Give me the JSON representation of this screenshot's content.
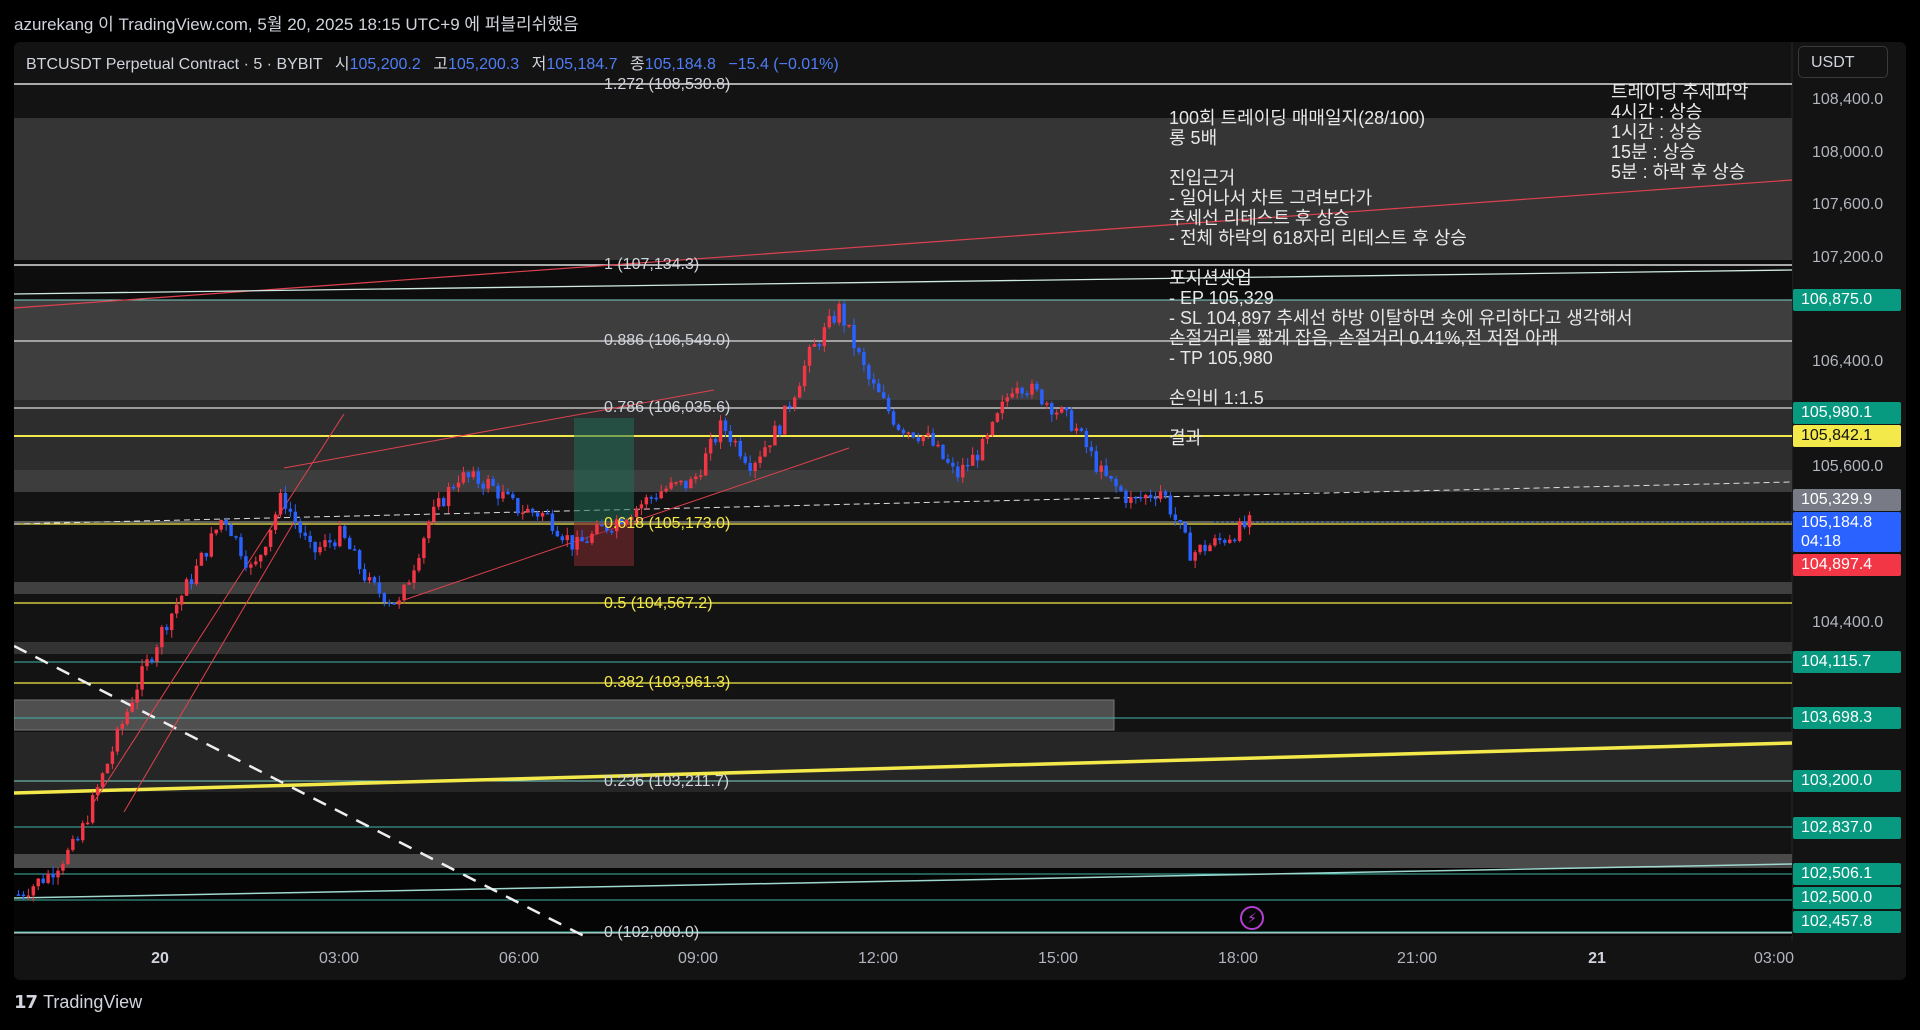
{
  "publish_line": "azurekang 이 TradingView.com, 5월 20, 2025 18:15 UTC+9 에 퍼블리쉬했음",
  "header": {
    "symbol": "BTCUSDT Perpetual Contract · 5 · BYBIT",
    "open_label": "시",
    "open_value": "105,200.2",
    "high_label": "고",
    "high_value": "105,200.3",
    "low_label": "저",
    "low_value": "105,184.7",
    "close_label": "종",
    "close_value": "105,184.8",
    "change": "−15.4 (−0.01%)"
  },
  "currency_button": "USDT",
  "notes": {
    "title": "100회 트레이딩 매매일지(28/100)",
    "leverage": "롱 5배",
    "entry_title": "진입근거",
    "entry_1": "- 일어나서 차트 그려보다가",
    "entry_2": "추세선 리테스트 후 상승",
    "entry_3": "- 전체 하락의 618자리 리테스트 후 상승",
    "setup_title": "포지션셋업",
    "setup_ep": "- EP 105,329",
    "setup_sl": "- SL 104,897 추세선 하방 이탈하면 숏에 유리하다고 생각해서",
    "setup_sl2": "손절거리를 짧게 잡음, 손절거리 0.41%,전 저점 아래",
    "setup_tp": "- TP 105,980",
    "rr": "손익비 1:1.5",
    "result": "결과"
  },
  "trend": {
    "title": "트레이딩 추세파악",
    "h4": "4시간 : 상승",
    "h1": "1시간 : 상승",
    "m15": "15분 : 상승",
    "m5": "5분 : 하락 후 상승"
  },
  "price_axis": [
    "108,400.0",
    "108,000.0",
    "107,600.0",
    "107,200.0",
    "106,400.0",
    "105,600.0",
    "104,400.0"
  ],
  "price_tags": [
    {
      "label": "106,875.0",
      "style": "green"
    },
    {
      "label": "105,980.1",
      "style": "green"
    },
    {
      "label": "105,842.1",
      "style": "yellow"
    },
    {
      "label": "105,329.9",
      "style": "gray"
    },
    {
      "label": "105,184.8",
      "style": "blue",
      "sub": "04:18"
    },
    {
      "label": "104,897.4",
      "style": "red"
    },
    {
      "label": "104,115.7",
      "style": "green"
    },
    {
      "label": "103,698.3",
      "style": "green"
    },
    {
      "label": "103,200.0",
      "style": "green"
    },
    {
      "label": "102,837.0",
      "style": "green"
    },
    {
      "label": "102,506.1",
      "style": "green"
    },
    {
      "label": "102,500.0",
      "style": "green"
    },
    {
      "label": "102,457.8",
      "style": "green"
    }
  ],
  "fib_levels": [
    {
      "label": "1.272 (108,530.8)",
      "color": "w"
    },
    {
      "label": "1 (107,134.3)",
      "color": "w"
    },
    {
      "label": "0.886 (106,549.0)",
      "color": "w"
    },
    {
      "label": "0.786 (106,035.6)",
      "color": "w"
    },
    {
      "label": "0.618 (105,173.0)",
      "color": "y"
    },
    {
      "label": "0.5 (104,567.2)",
      "color": "y"
    },
    {
      "label": "0.382 (103,961.3)",
      "color": "y"
    },
    {
      "label": "0.236 (103,211.7)",
      "color": "w"
    },
    {
      "label": "0 (102,000.0)",
      "color": "w"
    }
  ],
  "time_axis": [
    {
      "label": "20",
      "bold": true
    },
    {
      "label": "03:00"
    },
    {
      "label": "06:00"
    },
    {
      "label": "09:00"
    },
    {
      "label": "12:00"
    },
    {
      "label": "15:00"
    },
    {
      "label": "18:00"
    },
    {
      "label": "21:00"
    },
    {
      "label": "21",
      "bold": true
    },
    {
      "label": "03:00"
    }
  ],
  "chart_data": {
    "type": "candlestick",
    "symbol": "BTCUSDT",
    "interval": "5",
    "close_path": [
      102300,
      102450,
      102700,
      103300,
      103900,
      104400,
      104800,
      105250,
      104800,
      105400,
      104950,
      105100,
      104700,
      104550,
      105200,
      105550,
      105500,
      105300,
      105250,
      105000,
      105150,
      105300,
      105450,
      105500,
      105950,
      105650,
      105950,
      106500,
      106850,
      106300,
      105950,
      105850,
      105550,
      105800,
      106300,
      106150,
      105950,
      105550,
      105350,
      105450,
      104950,
      105050,
      105180
    ],
    "bull_color": "#f23645",
    "bear_color": "#2962ff",
    "last_price": 105184.8,
    "ylim": [
      102000,
      108600
    ],
    "time_ticks": [
      "20",
      "03:00",
      "06:00",
      "09:00",
      "12:00",
      "15:00",
      "18:00",
      "21:00",
      "21",
      "03:00"
    ]
  },
  "branding": "TradingView"
}
